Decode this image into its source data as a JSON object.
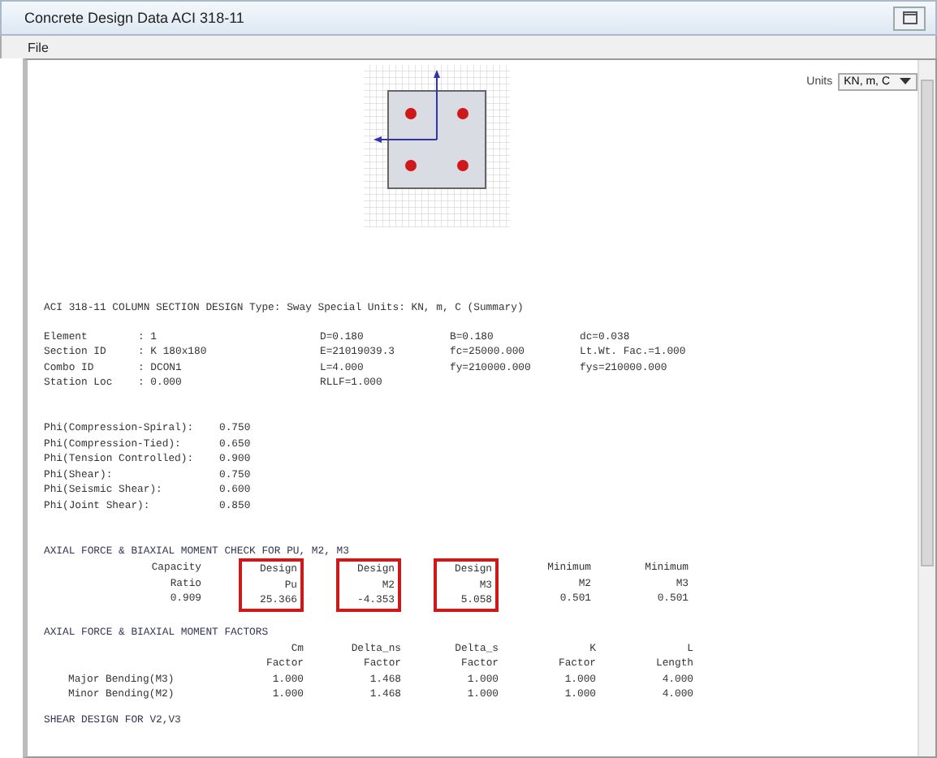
{
  "window": {
    "title": "Concrete Design Data  ACI 318-11"
  },
  "menu": [
    "File"
  ],
  "units": {
    "label": "Units",
    "value": "KN, m, C"
  },
  "heading": "ACI 318-11 COLUMN SECTION DESIGN   Type: Sway Special   Units: KN, m, C   (Summary)",
  "info_rows": [
    {
      "label": "Element",
      "value": ": 1",
      "cells": [
        "D=0.180",
        "B=0.180",
        "dc=0.038"
      ]
    },
    {
      "label": "Section ID",
      "value": ": K 180x180",
      "cells": [
        "E=21019039.3",
        "fc=25000.000",
        "Lt.Wt. Fac.=1.000"
      ]
    },
    {
      "label": "Combo ID",
      "value": ": DCON1",
      "cells": [
        "L=4.000",
        "fy=210000.000",
        "fys=210000.000"
      ]
    },
    {
      "label": "Station Loc",
      "value": ": 0.000",
      "cells": [
        "RLLF=1.000"
      ]
    }
  ],
  "phi_factors": [
    {
      "label": "Phi(Compression-Spiral):",
      "value": "0.750"
    },
    {
      "label": "Phi(Compression-Tied):",
      "value": "0.650"
    },
    {
      "label": "Phi(Tension Controlled):",
      "value": "0.900"
    },
    {
      "label": "Phi(Shear):",
      "value": "0.750"
    },
    {
      "label": "Phi(Seismic Shear):",
      "value": "0.600"
    },
    {
      "label": "Phi(Joint Shear):",
      "value": "0.850"
    }
  ],
  "check": {
    "title": "AXIAL FORCE & BIAXIAL MOMENT CHECK FOR PU, M2, M3",
    "columns": [
      {
        "header": [
          "Capacity",
          "Ratio"
        ],
        "value": "0.909",
        "highlighted": false
      },
      {
        "header": [
          "Design",
          "Pu"
        ],
        "value": "25.366",
        "highlighted": true
      },
      {
        "header": [
          "Design",
          "M2"
        ],
        "value": "-4.353",
        "highlighted": true
      },
      {
        "header": [
          "Design",
          "M3"
        ],
        "value": "5.058",
        "highlighted": true
      },
      {
        "header": [
          "Minimum",
          "M2"
        ],
        "value": "0.501",
        "highlighted": false
      },
      {
        "header": [
          "Minimum",
          "M3"
        ],
        "value": "0.501",
        "highlighted": false
      }
    ]
  },
  "factors": {
    "title": "AXIAL FORCE & BIAXIAL MOMENT FACTORS",
    "columns": [
      [
        "Cm",
        "Factor"
      ],
      [
        "Delta_ns",
        "Factor"
      ],
      [
        "Delta_s",
        "Factor"
      ],
      [
        "K",
        "Factor"
      ],
      [
        "L",
        "Length"
      ]
    ],
    "rows": [
      {
        "label": "Major Bending(M3)",
        "values": [
          "1.000",
          "1.468",
          "1.000",
          "1.000",
          "4.000"
        ]
      },
      {
        "label": "Minor Bending(M2)",
        "values": [
          "1.000",
          "1.468",
          "1.000",
          "1.000",
          "4.000"
        ]
      }
    ]
  },
  "next_heading": "SHEAR DESIGN FOR V2,V3"
}
